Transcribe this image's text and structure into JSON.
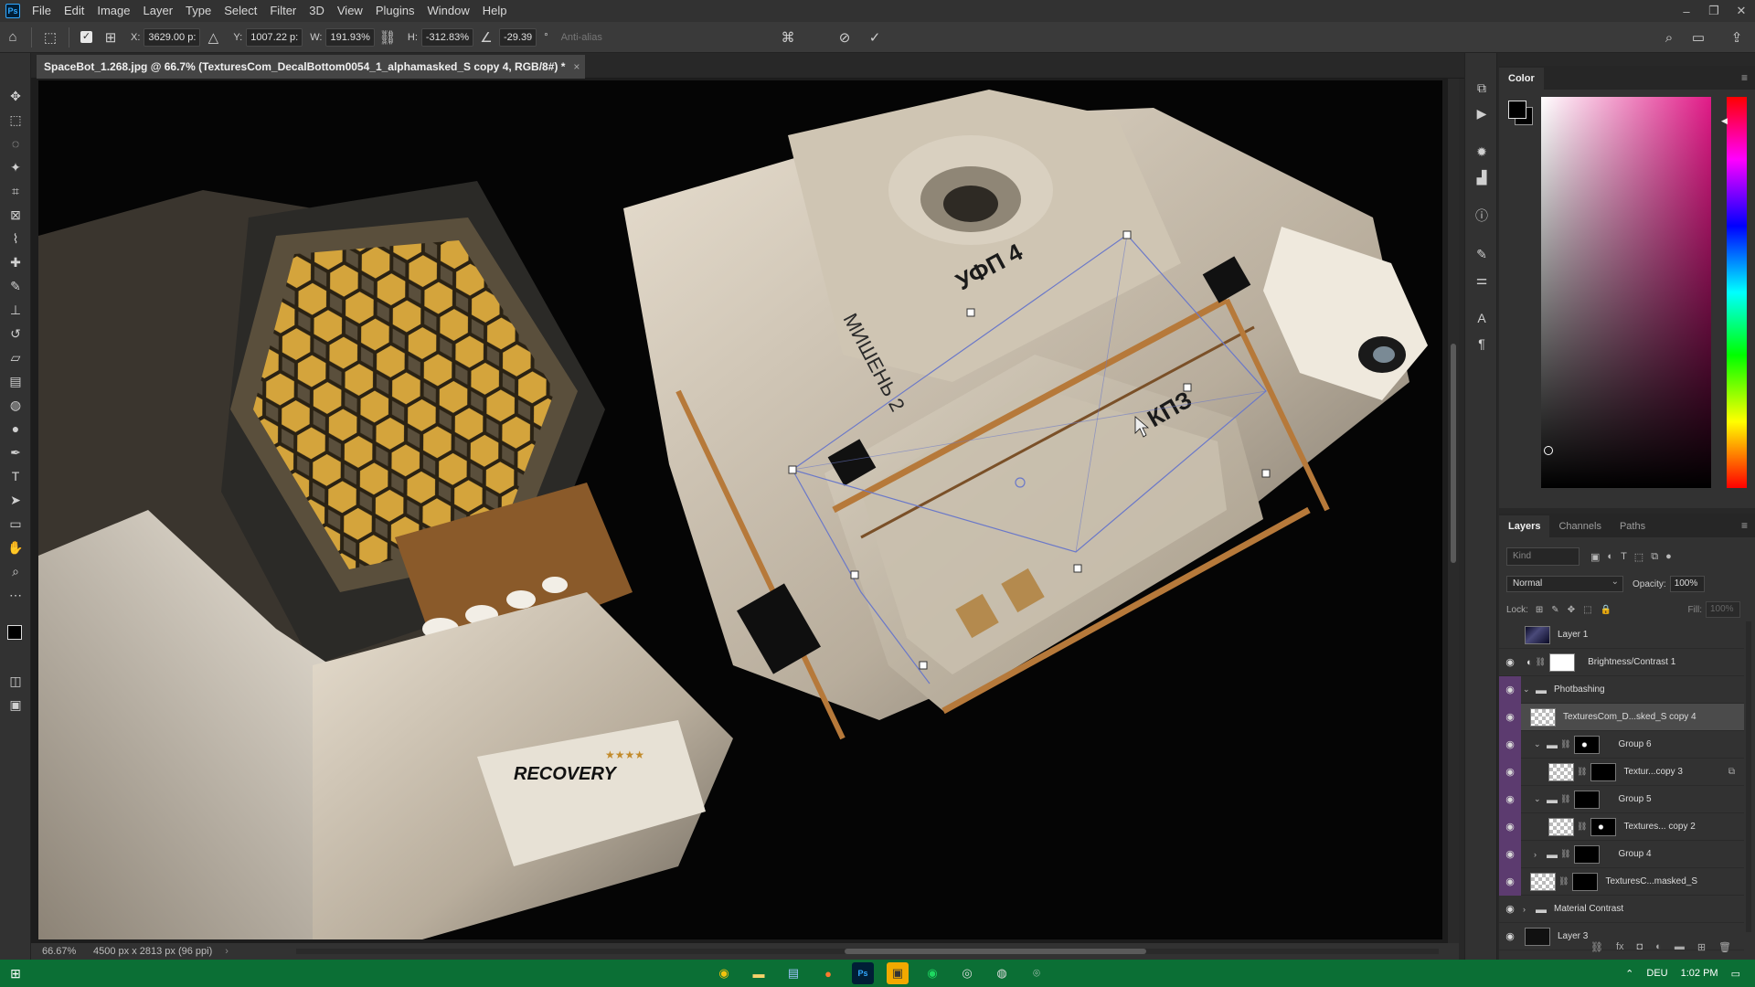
{
  "app": {
    "logo": "Ps"
  },
  "menu": [
    "File",
    "Edit",
    "Image",
    "Layer",
    "Type",
    "Select",
    "Filter",
    "3D",
    "View",
    "Plugins",
    "Window",
    "Help"
  ],
  "window_controls": {
    "minimize": "–",
    "restore": "❐",
    "close": "✕"
  },
  "options": {
    "x_label": "X:",
    "x_value": "3629.00 p:",
    "y_label": "Y:",
    "y_value": "1007.22 p:",
    "w_label": "W:",
    "w_value": "191.93%",
    "h_label": "H:",
    "h_value": "-312.83%",
    "angle_value": "-29.39",
    "angle_unit": "°",
    "antialias_label": "Anti-alias"
  },
  "document": {
    "tab_title": "SpaceBot_1.268.jpg @ 66.7% (TexturesCom_DecalBottom0054_1_alphamasked_S copy 4, RGB/8#) *",
    "close": "×"
  },
  "canvas_text": {
    "ufp": "УФП 4",
    "mishen": "МИШЕНЬ 2",
    "kp": "КПЗ",
    "recovery": "RECOVERY",
    "stars": "★★★★"
  },
  "status": {
    "zoom": "66.67%",
    "doc_info": "4500 px x 2813 px (96 ppi)",
    "arrow": "›"
  },
  "color_panel": {
    "title": "Color",
    "fg_color": "#000000",
    "bg_color": "#000000",
    "hue_color": "#e11a87"
  },
  "layers_panel": {
    "tabs": [
      "Layers",
      "Channels",
      "Paths"
    ],
    "kind_placeholder": "Kind",
    "blend_mode": "Normal",
    "opacity_label": "Opacity:",
    "opacity_value": "100%",
    "lock_label": "Lock:",
    "fill_label": "Fill:",
    "fill_value": "100%",
    "layers": [
      {
        "name": "Layer 1"
      },
      {
        "name": "Brightness/Contrast 1"
      },
      {
        "name": "Photbashing"
      },
      {
        "name": "TexturesCom_D...sked_S copy 4"
      },
      {
        "name": "Group 6"
      },
      {
        "name": "Textur...copy 3"
      },
      {
        "name": "Group 5"
      },
      {
        "name": "Textures... copy 2"
      },
      {
        "name": "Group 4"
      },
      {
        "name": "TexturesC...masked_S"
      },
      {
        "name": "Material Contrast"
      },
      {
        "name": "Layer 3"
      }
    ]
  },
  "taskbar": {
    "language": "DEU",
    "time": "1:02 PM"
  }
}
